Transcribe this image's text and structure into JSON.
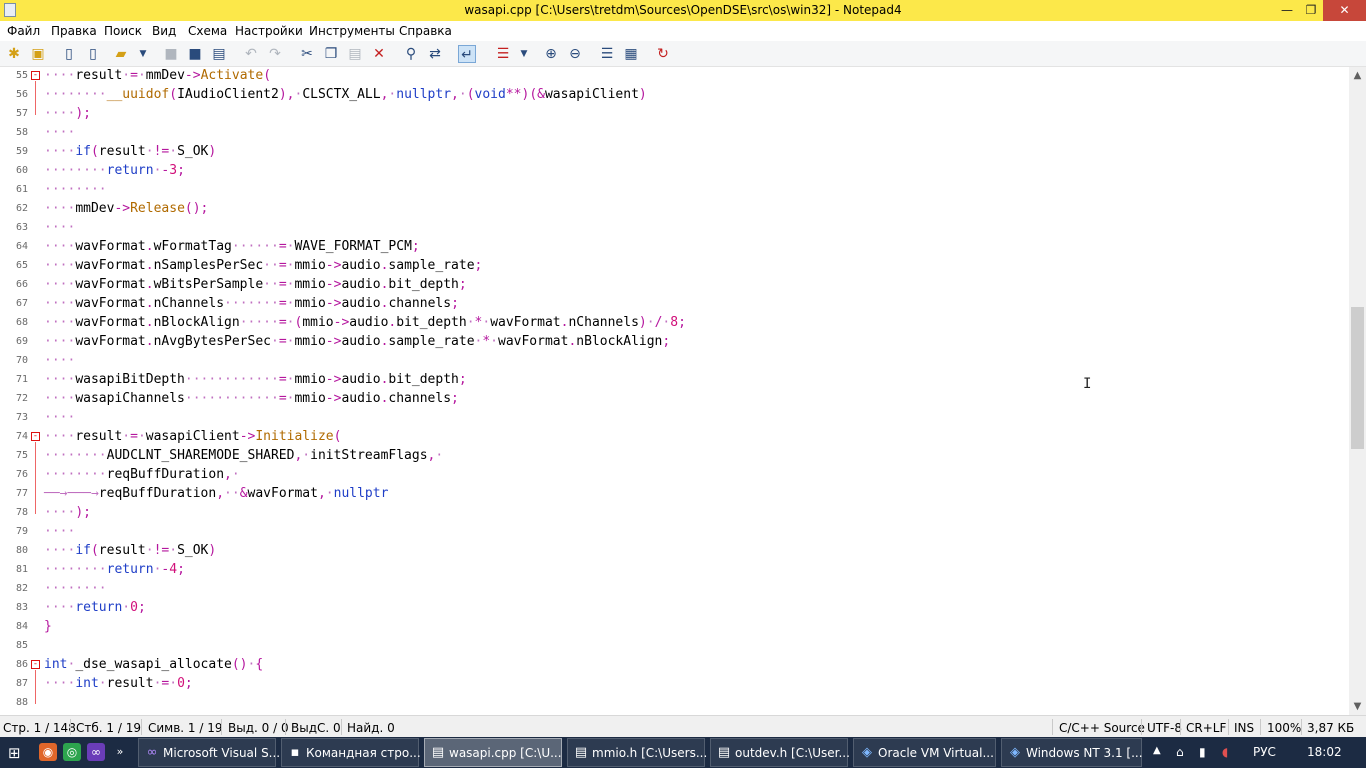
{
  "window": {
    "title": "wasapi.cpp [C:\\Users\\tretdm\\Sources\\OpenDSE\\src\\os\\win32] - Notepad4",
    "min_glyph": "—",
    "max_glyph": "❐",
    "close_glyph": "✕"
  },
  "menu": [
    "Файл",
    "Правка",
    "Поиск",
    "Вид",
    "Схема",
    "Настройки",
    "Инструменты",
    "Справка"
  ],
  "toolbar": {
    "icons": [
      "new-icon",
      "open-icon",
      "new-file-icon",
      "new-window-icon",
      "browse-icon",
      "dropdown-arrow-icon",
      "save-icon",
      "save-as-icon",
      "save-copy-icon",
      "undo-icon",
      "redo-icon",
      "cut-icon",
      "copy-icon",
      "paste-icon",
      "delete-icon",
      "find-icon",
      "replace-icon",
      "word-wrap-icon",
      "scheme-icon",
      "dropdown-arrow-icon",
      "zoom-in-icon",
      "zoom-out-icon",
      "settings-icon",
      "print-icon",
      "reload-icon"
    ]
  },
  "editor": {
    "lines": [
      {
        "n": "55",
        "fold": "-",
        "t": "····result·=·mmDev->Activate("
      },
      {
        "n": "56",
        "t": "········__uuidof(IAudioClient2),·CLSCTX_ALL,·nullptr,·(void**)(&wasapiClient)"
      },
      {
        "n": "57",
        "t": "····);"
      },
      {
        "n": "58",
        "t": "····"
      },
      {
        "n": "59",
        "t": "····if(result·!=·S_OK)"
      },
      {
        "n": "60",
        "t": "········return·-3;"
      },
      {
        "n": "61",
        "t": "········"
      },
      {
        "n": "62",
        "t": "····mmDev->Release();"
      },
      {
        "n": "63",
        "t": "····"
      },
      {
        "n": "64",
        "t": "····wavFormat.wFormatTag······=·WAVE_FORMAT_PCM;"
      },
      {
        "n": "65",
        "t": "····wavFormat.nSamplesPerSec··=·mmio->audio.sample_rate;"
      },
      {
        "n": "66",
        "t": "····wavFormat.wBitsPerSample··=·mmio->audio.bit_depth;"
      },
      {
        "n": "67",
        "t": "····wavFormat.nChannels·······=·mmio->audio.channels;"
      },
      {
        "n": "68",
        "t": "····wavFormat.nBlockAlign·····=·(mmio->audio.bit_depth·*·wavFormat.nChannels)·/·8;"
      },
      {
        "n": "69",
        "t": "····wavFormat.nAvgBytesPerSec·=·mmio->audio.sample_rate·*·wavFormat.nBlockAlign;"
      },
      {
        "n": "70",
        "t": "····"
      },
      {
        "n": "71",
        "t": "····wasapiBitDepth············=·mmio->audio.bit_depth;"
      },
      {
        "n": "72",
        "t": "····wasapiChannels············=·mmio->audio.channels;"
      },
      {
        "n": "73",
        "t": "····"
      },
      {
        "n": "74",
        "fold": "-",
        "t": "····result·=·wasapiClient->Initialize("
      },
      {
        "n": "75",
        "t": "········AUDCLNT_SHAREMODE_SHARED,·initStreamFlags,·"
      },
      {
        "n": "76",
        "t": "········reqBuffDuration,·"
      },
      {
        "n": "77",
        "t": "──→───→reqBuffDuration,··&wavFormat,·nullptr"
      },
      {
        "n": "78",
        "t": "····);"
      },
      {
        "n": "79",
        "t": "····"
      },
      {
        "n": "80",
        "t": "····if(result·!=·S_OK)"
      },
      {
        "n": "81",
        "t": "········return·-4;"
      },
      {
        "n": "82",
        "t": "········"
      },
      {
        "n": "83",
        "t": "····return·0;"
      },
      {
        "n": "84",
        "t": "}"
      },
      {
        "n": "85",
        "t": ""
      },
      {
        "n": "86",
        "fold": "-",
        "t": "int·_dse_wasapi_allocate()·{"
      },
      {
        "n": "87",
        "t": "····int·result·=·0;"
      },
      {
        "n": "88",
        "t": ""
      }
    ]
  },
  "colors": {
    "keyword": "#1f3ec7",
    "function": "#b06a00",
    "number": "#d1107a",
    "operator": "#b5179e",
    "whitespace_dot": "#c070c0",
    "fold_marker": "#dd1111",
    "member_highlight": "#2b8ad8"
  },
  "status": {
    "line": "Стр. 1 / 148",
    "col": "Стб. 1 / 19",
    "chars": "Симв. 1 / 19",
    "sel": "Выд. 0 / 0",
    "selc": "ВыдС. 0",
    "found": "Найд. 0",
    "lang": "C/C++ Source",
    "enc": "UTF-8",
    "eol": "CR+LF",
    "ins": "INS",
    "zoom": "100%",
    "size": "3,87 КБ"
  },
  "taskbar": {
    "tasks": [
      {
        "icon": "visual-studio-icon",
        "label": "Microsoft Visual S..."
      },
      {
        "icon": "console-icon",
        "label": "Командная стро..."
      },
      {
        "icon": "notepad-icon",
        "label": "wasapi.cpp [C:\\U..."
      },
      {
        "icon": "notepad-icon",
        "label": "mmio.h [C:\\Users..."
      },
      {
        "icon": "notepad-icon",
        "label": "outdev.h [C:\\User..."
      },
      {
        "icon": "virtualbox-icon",
        "label": "Oracle VM Virtual..."
      },
      {
        "icon": "virtualbox-icon",
        "label": "Windows NT 3.1 [..."
      }
    ],
    "lang": "РУС",
    "time": "18:02"
  }
}
